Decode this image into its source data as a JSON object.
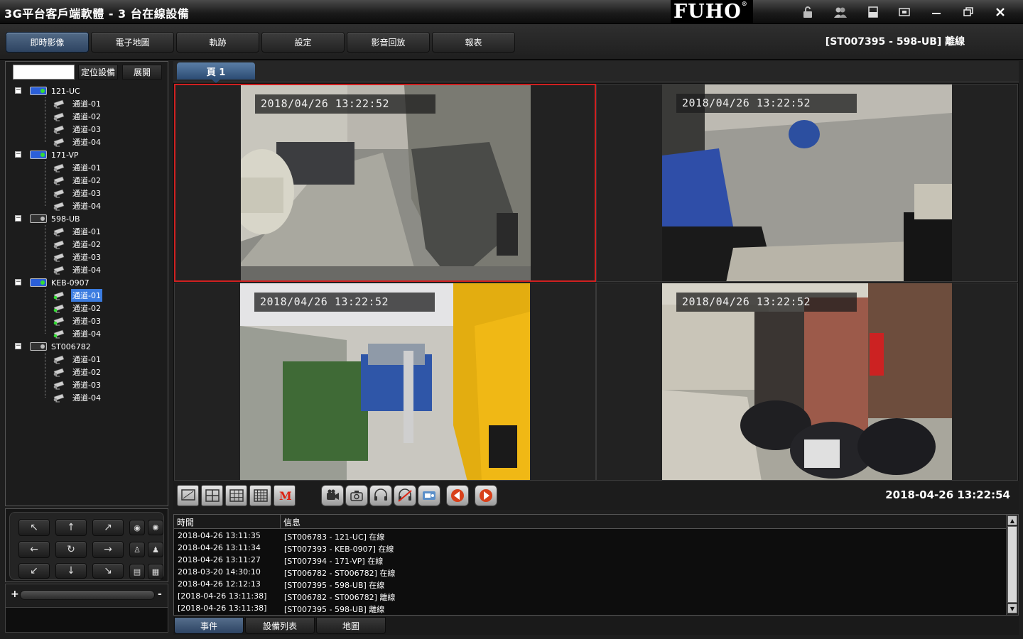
{
  "window": {
    "title": "3G平台客戶端軟體 - 3 台在線設備",
    "brand": "FUHO",
    "brand_mark": "®",
    "controls": [
      "lock-icon",
      "users-icon",
      "layout-icon",
      "restore-window-icon",
      "minimize-icon",
      "maximize-icon",
      "close-icon"
    ]
  },
  "menu": {
    "tabs": [
      "即時影像",
      "電子地圖",
      "軌跡",
      "設定",
      "影音回放",
      "報表"
    ],
    "active_index": 0,
    "status": "[ST007395 - 598-UB] 離線"
  },
  "device_panel": {
    "search_placeholder": "",
    "locate_button": "定位設備",
    "expand_button": "展開",
    "devices": [
      {
        "name": "121-UC",
        "online": true,
        "channels": [
          "通道-01",
          "通道-02",
          "通道-03",
          "通道-04"
        ]
      },
      {
        "name": "171-VP",
        "online": true,
        "channels": [
          "通道-01",
          "通道-02",
          "通道-03",
          "通道-04"
        ]
      },
      {
        "name": "598-UB",
        "online": false,
        "channels": [
          "通道-01",
          "通道-02",
          "通道-03",
          "通道-04"
        ]
      },
      {
        "name": "KEB-0907",
        "online": true,
        "channels": [
          "通道-01",
          "通道-02",
          "通道-03",
          "通道-04"
        ],
        "selected_channel": 0
      },
      {
        "name": "ST006782",
        "online": false,
        "channels": [
          "通道-01",
          "通道-02",
          "通道-03",
          "通道-04"
        ]
      }
    ]
  },
  "ptz": {
    "buttons": [
      "arrow-up-left",
      "arrow-up",
      "arrow-up-right",
      "arrow-left",
      "rotate",
      "arrow-right",
      "arrow-down-left",
      "arrow-down",
      "arrow-down-right"
    ],
    "zoom_plus": "+",
    "zoom_minus": "-"
  },
  "video": {
    "page_tab": "頁 1",
    "tiles": [
      {
        "timestamp": "2018/04/26 13:22:52",
        "selected": true
      },
      {
        "timestamp": "2018/04/26 13:22:52",
        "selected": false
      },
      {
        "timestamp": "2018/04/26 13:22:52",
        "selected": false
      },
      {
        "timestamp": "2018/04/26 13:22:52",
        "selected": false
      }
    ]
  },
  "toolbar": {
    "clock": "2018-04-26 13:22:54",
    "layout_icons": [
      "single-view-icon",
      "four-view-icon",
      "nine-view-icon",
      "sixteen-view-icon",
      "custom-layout-icon"
    ],
    "action_icons": [
      "record-icon",
      "snapshot-icon",
      "open-audio-icon",
      "close-audio-icon",
      "intercom-icon",
      "prev-page-icon",
      "next-page-icon"
    ]
  },
  "log": {
    "col_time": "時間",
    "col_info": "信息",
    "rows": [
      {
        "time": "2018-04-26 13:11:35",
        "info": "[ST006783 - 121-UC] 在線"
      },
      {
        "time": "2018-04-26 13:11:34",
        "info": "[ST007393 - KEB-0907] 在線"
      },
      {
        "time": "2018-04-26 13:11:27",
        "info": "[ST007394 - 171-VP] 在線"
      },
      {
        "time": "2018-03-20 14:30:10",
        "info": "[ST006782 - ST006782] 在線"
      },
      {
        "time": "2018-04-26 12:12:13",
        "info": "[ST007395 - 598-UB] 在線"
      },
      {
        "time": "[2018-04-26 13:11:38]",
        "info": "[ST006782 - ST006782] 離線"
      },
      {
        "time": "[2018-04-26 13:11:38]",
        "info": "[ST007395 - 598-UB] 離線"
      }
    ]
  },
  "bottom_tabs": [
    "事件",
    "設備列表",
    "地圖"
  ],
  "colors": {
    "accent_blue": "#3b7ce0",
    "selected_border": "#d02020",
    "online_led": "#33dd33"
  }
}
